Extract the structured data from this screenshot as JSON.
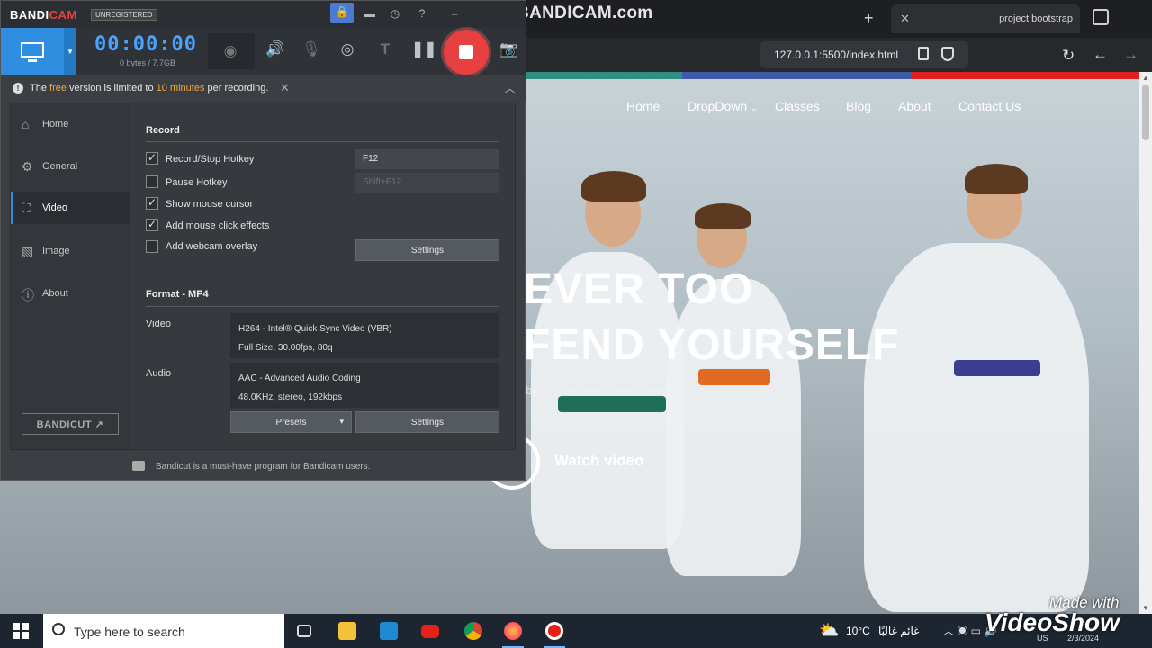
{
  "browser": {
    "tab_title": "project bootstrap",
    "tab_close": "✕",
    "new_tab": "+",
    "url": "127.0.0.1:5500/index.html",
    "watermark": "www.BANDICAM.com"
  },
  "site": {
    "nav": [
      "Home",
      "DropDown",
      "Classes",
      "Blog",
      "About",
      "Contact Us"
    ],
    "hero_line1": "EVER TOO",
    "hero_line2": "FEND YOURSELF",
    "hero_sub": "behind the word mountains",
    "watch_label": "Watch video",
    "colorbar": [
      "#2f8f83",
      "#3e5aa8",
      "#e02020"
    ]
  },
  "bandicam": {
    "logo_a": "BANDI",
    "logo_b": "CAM",
    "unregistered": "UNREGISTERED",
    "timer": "00:00:00",
    "bytes": "0 bytes / 7.7GB",
    "notice_a": "The ",
    "notice_free": "free",
    "notice_b": " version is limited to ",
    "notice_min": "10 minutes",
    "notice_c": " per recording.",
    "sidebar": [
      "Home",
      "General",
      "Video",
      "Image",
      "About"
    ],
    "active_item": "Video",
    "bandicut_label": "BANDICUT ↗",
    "record": {
      "title": "Record",
      "hotkey_label": "Record/Stop Hotkey",
      "hotkey_value": "F12",
      "pause_label": "Pause Hotkey",
      "pause_value": "Shift+F12",
      "cursor_label": "Show mouse cursor",
      "click_label": "Add mouse click effects",
      "webcam_label": "Add webcam overlay",
      "settings": "Settings"
    },
    "format": {
      "title": "Format - MP4",
      "video_label": "Video",
      "video_line1": "H264 - Intel® Quick Sync Video (VBR)",
      "video_line2": "Full Size, 30.00fps, 80q",
      "audio_label": "Audio",
      "audio_line1": "AAC - Advanced Audio Coding",
      "audio_line2": "48.0KHz, stereo, 192kbps",
      "presets": "Presets",
      "settings": "Settings"
    },
    "footer": "Bandicut is a must-have program for Bandicam users."
  },
  "taskbar": {
    "search_placeholder": "Type here to search",
    "temperature": "10°C",
    "weather_text": "غائم غالبًا",
    "lang": "US",
    "date": "2/3/2024",
    "videoshow_a": "Made with",
    "videoshow_b": "VideoShow"
  }
}
